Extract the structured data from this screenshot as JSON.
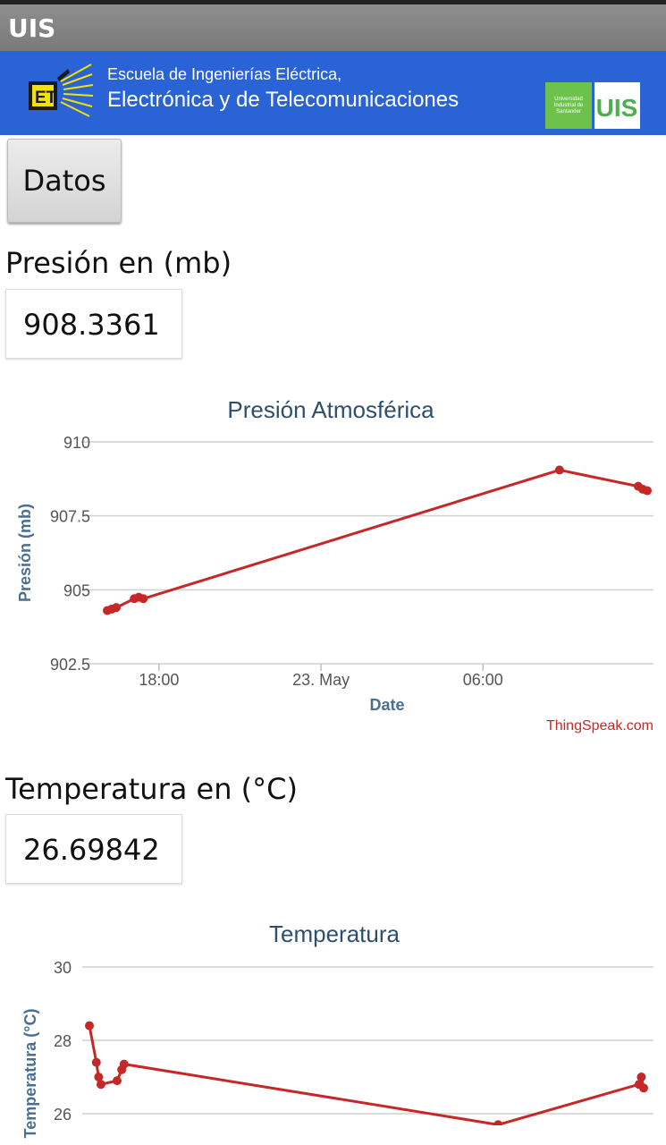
{
  "window": {
    "title": "UIS"
  },
  "banner": {
    "line1": "Escuela de Ingenierías Eléctrica,",
    "line2": "Electrónica y de Telecomunicaciones",
    "logo_left_text": "ET",
    "logo_right_small": [
      "Universidad",
      "Industrial de",
      "Santander"
    ],
    "logo_right_text": "UIS"
  },
  "datos_button": "Datos",
  "pressure": {
    "label": "Presión en (mb)",
    "value": "908.3361"
  },
  "temperature": {
    "label": "Temperatura en (°C)",
    "value": "26.69842"
  },
  "credit": "ThingSpeak.com",
  "colors": {
    "line": "#c62828",
    "title": "#2f4f6f",
    "axis": "#4a6f94",
    "banner": "#2a63d6"
  },
  "chart_data": [
    {
      "type": "line",
      "title": "Presión Atmosférica",
      "xlabel": "Date",
      "ylabel": "Presión (mb)",
      "ylim": [
        902.5,
        910
      ],
      "yticks": [
        "910",
        "907.5",
        "905",
        "902.5"
      ],
      "xticks": [
        "18:00",
        "23. May",
        "06:00"
      ],
      "grid": true,
      "series": [
        {
          "values": [
            {
              "x": "22 May 16:05",
              "y": 904.3
            },
            {
              "x": "22 May 16:15",
              "y": 904.35
            },
            {
              "x": "22 May 16:25",
              "y": 904.4
            },
            {
              "x": "22 May 17:05",
              "y": 904.7
            },
            {
              "x": "22 May 17:15",
              "y": 904.75
            },
            {
              "x": "22 May 17:25",
              "y": 904.7
            },
            {
              "x": "23 May 08:50",
              "y": 909.05
            },
            {
              "x": "23 May 11:45",
              "y": 908.5
            },
            {
              "x": "23 May 11:55",
              "y": 908.4
            },
            {
              "x": "23 May 12:05",
              "y": 908.35
            }
          ]
        }
      ]
    },
    {
      "type": "line",
      "title": "Temperatura",
      "ylabel": "Temperatura (°C)",
      "ylim": [
        24,
        30
      ],
      "yticks": [
        "30",
        "28",
        "26"
      ],
      "grid": true,
      "series": [
        {
          "values": [
            {
              "x": "22 May 16:00",
              "y": 28.4
            },
            {
              "x": "22 May 16:15",
              "y": 27.4
            },
            {
              "x": "22 May 16:20",
              "y": 27.0
            },
            {
              "x": "22 May 16:25",
              "y": 26.8
            },
            {
              "x": "22 May 17:00",
              "y": 26.9
            },
            {
              "x": "22 May 17:10",
              "y": 27.2
            },
            {
              "x": "22 May 17:15",
              "y": 27.35
            },
            {
              "x": "23 May 06:45",
              "y": 25.7
            },
            {
              "x": "23 May 11:50",
              "y": 26.8
            },
            {
              "x": "23 May 11:55",
              "y": 27.0
            },
            {
              "x": "23 May 12:00",
              "y": 26.7
            }
          ]
        }
      ]
    }
  ]
}
